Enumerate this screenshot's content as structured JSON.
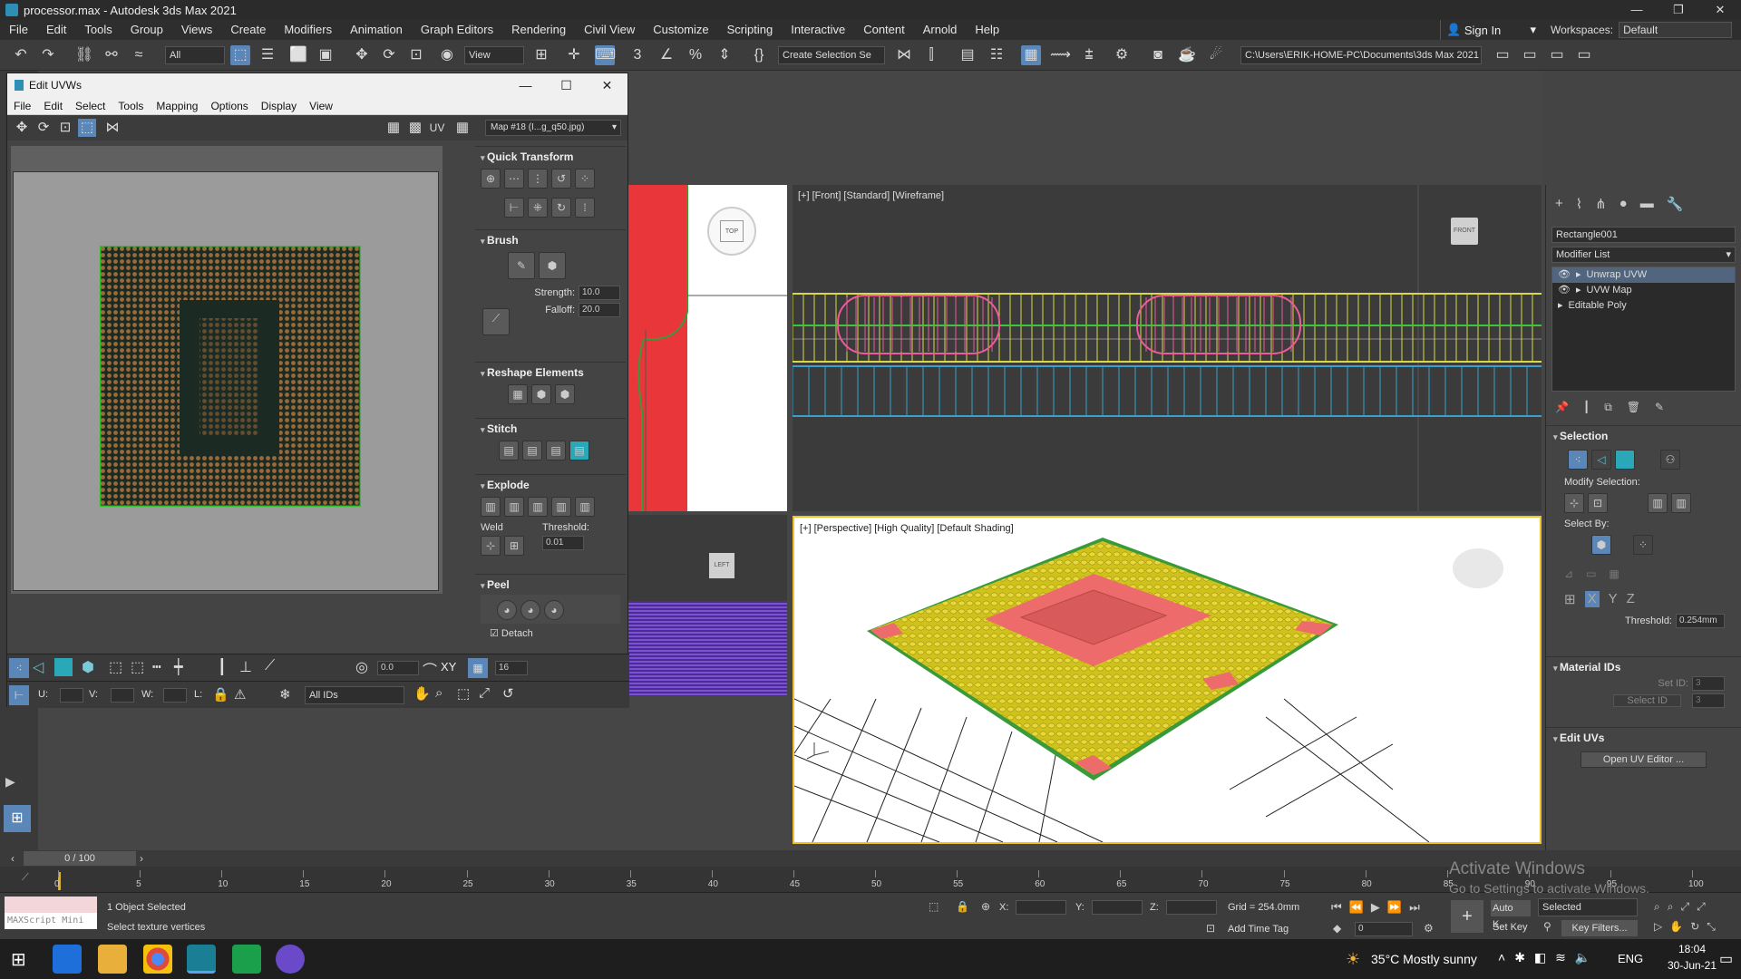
{
  "window": {
    "title": "processor.max - Autodesk 3ds Max 2021",
    "btn_min": "—",
    "btn_max": "❐",
    "btn_close": "✕"
  },
  "menu": [
    "File",
    "Edit",
    "Tools",
    "Group",
    "Views",
    "Create",
    "Modifiers",
    "Animation",
    "Graph Editors",
    "Rendering",
    "Civil View",
    "Customize",
    "Scripting",
    "Interactive",
    "Content",
    "Arnold",
    "Help"
  ],
  "signin": "Sign In",
  "workspaces": {
    "label": "Workspaces:",
    "value": "Default"
  },
  "toolbar": {
    "filter": "All",
    "refcoord": "View",
    "named_selection": "Create Selection Se",
    "path": "C:\\Users\\ERIK-HOME-PC\\Documents\\3ds Max 2021"
  },
  "uv": {
    "title": "Edit UVWs",
    "menu": [
      "File",
      "Edit",
      "Select",
      "Tools",
      "Mapping",
      "Options",
      "Display",
      "View"
    ],
    "uv_label": "UV",
    "map": "Map #18 (I...g_q50.jpg)",
    "sections": {
      "quick_transform": "Quick Transform",
      "brush": "Brush",
      "strength_label": "Strength:",
      "strength": "10.0",
      "falloff_label": "Falloff:",
      "falloff": "20.0",
      "reshape": "Reshape Elements",
      "stitch": "Stitch",
      "explode": "Explode",
      "weld": "Weld",
      "threshold_label": "Threshold:",
      "threshold": "0.01",
      "peel": "Peel",
      "detach": "Detach"
    },
    "bottom": {
      "value": "0.0",
      "xy": "XY",
      "count": "16",
      "u": "U:",
      "v": "V:",
      "w": "W:",
      "l": "L:",
      "ids": "All IDs"
    }
  },
  "viewports": {
    "front": "[+] [Front] [Standard] [Wireframe]",
    "perspective": "[+] [Perspective] [High Quality] [Default Shading]",
    "top_cube": "TOP",
    "front_cube": "FRONT",
    "left_cube": "LEFT"
  },
  "cmd": {
    "object_name": "Rectangle001",
    "modifier_list": "Modifier List",
    "stack": [
      "Unwrap UVW",
      "UVW Map",
      "Editable Poly"
    ],
    "selection": "Selection",
    "modify_selection": "Modify Selection:",
    "select_by": "Select By:",
    "threshold_label": "Threshold:",
    "threshold": "0.254mm",
    "material_ids": "Material IDs",
    "set_id_label": "Set ID:",
    "set_id": "3",
    "select_id_label": "Select ID",
    "select_id": "3",
    "edit_uvs": "Edit UVs",
    "open_uv_editor": "Open UV Editor ..."
  },
  "timeline": {
    "frame": "0 / 100",
    "ticks": [
      "0",
      "5",
      "10",
      "15",
      "20",
      "25",
      "30",
      "35",
      "40",
      "45",
      "50",
      "55",
      "60",
      "65",
      "70",
      "75",
      "80",
      "85",
      "90",
      "95",
      "100"
    ]
  },
  "status": {
    "maxscript": "MAXScript Mini",
    "selected": "1 Object Selected",
    "prompt": "Select texture vertices",
    "x": "X:",
    "y": "Y:",
    "z": "Z:",
    "grid": "Grid = 254.0mm",
    "add_time_tag": "Add Time Tag",
    "autokey": "Auto K...",
    "setkey": "Set Key",
    "selected_dd": "Selected",
    "key_filters": "Key Filters...",
    "frame_val": "0"
  },
  "watermark": {
    "line1": "Activate Windows",
    "line2": "Go to Settings to activate Windows."
  },
  "taskbar": {
    "weather": "35°C  Mostly sunny",
    "lang": "ENG",
    "time": "18:04",
    "date": "30-Jun-21"
  },
  "colors": {
    "accent": "#5a86b8",
    "uv_green": "#2ac02a",
    "mesh_yellow": "#d8c81e",
    "mesh_red": "#e86a6a"
  }
}
